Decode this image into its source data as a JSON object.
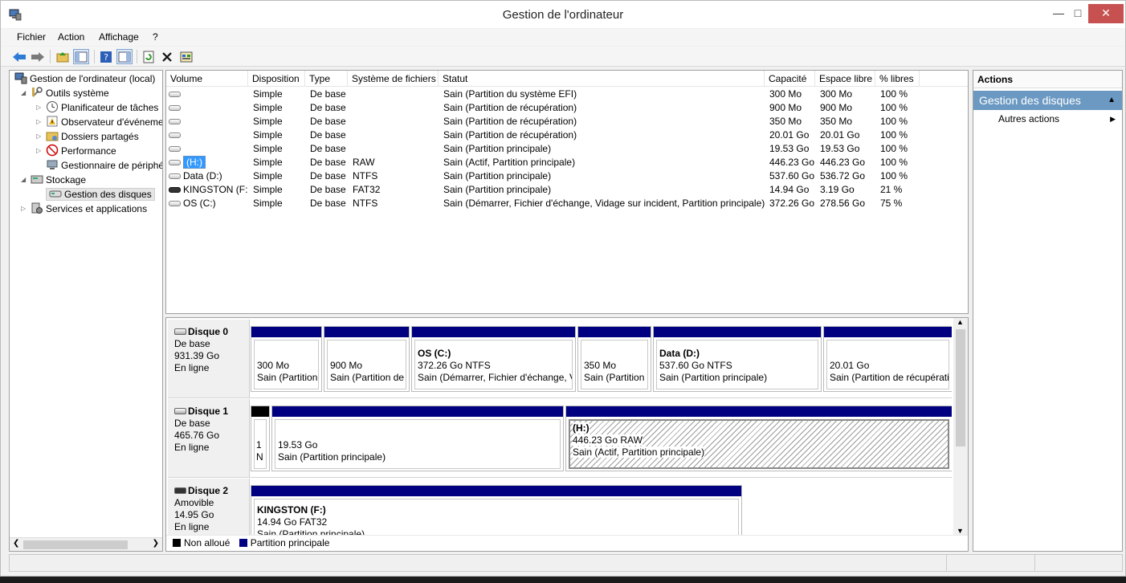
{
  "window": {
    "title": "Gestion de l'ordinateur"
  },
  "menu": [
    "Fichier",
    "Action",
    "Affichage",
    "?"
  ],
  "toolbar": {
    "icons": [
      "back-icon",
      "forward-icon",
      "up-icon",
      "show-tree-icon",
      "help-icon",
      "properties-icon",
      "refresh-icon",
      "delete-icon",
      "export-icon"
    ]
  },
  "tree": {
    "root": "Gestion de l'ordinateur (local)",
    "system_tools": "Outils système",
    "task_scheduler": "Planificateur de tâches",
    "event_viewer": "Observateur d'événeme",
    "shared_folders": "Dossiers partagés",
    "performance": "Performance",
    "device_manager": "Gestionnaire de périphé",
    "storage": "Stockage",
    "disk_management": "Gestion des disques",
    "services": "Services et applications"
  },
  "volumes": {
    "headers": [
      "Volume",
      "Disposition",
      "Type",
      "Système de fichiers",
      "Statut",
      "Capacité",
      "Espace libre",
      "% libres"
    ],
    "rows": [
      {
        "volume": "",
        "disposition": "Simple",
        "type": "De base",
        "fs": "",
        "status": "Sain (Partition du système EFI)",
        "capacity": "300 Mo",
        "free": "300 Mo",
        "pct": "100 %"
      },
      {
        "volume": "",
        "disposition": "Simple",
        "type": "De base",
        "fs": "",
        "status": "Sain (Partition de récupération)",
        "capacity": "900 Mo",
        "free": "900 Mo",
        "pct": "100 %"
      },
      {
        "volume": "",
        "disposition": "Simple",
        "type": "De base",
        "fs": "",
        "status": "Sain (Partition de récupération)",
        "capacity": "350 Mo",
        "free": "350 Mo",
        "pct": "100 %"
      },
      {
        "volume": "",
        "disposition": "Simple",
        "type": "De base",
        "fs": "",
        "status": "Sain (Partition de récupération)",
        "capacity": "20.01 Go",
        "free": "20.01 Go",
        "pct": "100 %"
      },
      {
        "volume": "",
        "disposition": "Simple",
        "type": "De base",
        "fs": "",
        "status": "Sain (Partition principale)",
        "capacity": "19.53 Go",
        "free": "19.53 Go",
        "pct": "100 %"
      },
      {
        "volume": "(H:)",
        "disposition": "Simple",
        "type": "De base",
        "fs": "RAW",
        "status": "Sain (Actif, Partition principale)",
        "capacity": "446.23 Go",
        "free": "446.23 Go",
        "pct": "100 %"
      },
      {
        "volume": "Data (D:)",
        "disposition": "Simple",
        "type": "De base",
        "fs": "NTFS",
        "status": "Sain (Partition principale)",
        "capacity": "537.60 Go",
        "free": "536.72 Go",
        "pct": "100 %"
      },
      {
        "volume": "KINGSTON (F:)",
        "disposition": "Simple",
        "type": "De base",
        "fs": "FAT32",
        "status": "Sain (Partition principale)",
        "capacity": "14.94 Go",
        "free": "3.19 Go",
        "pct": "21 %"
      },
      {
        "volume": "OS (C:)",
        "disposition": "Simple",
        "type": "De base",
        "fs": "NTFS",
        "status": "Sain (Démarrer, Fichier d'échange, Vidage sur incident, Partition principale)",
        "capacity": "372.26 Go",
        "free": "278.56 Go",
        "pct": "75 %"
      }
    ]
  },
  "disks": [
    {
      "name": "Disque 0",
      "kind": "De base",
      "size": "931.39 Go",
      "state": "En ligne",
      "partitions": [
        {
          "title": "",
          "size": "300 Mo",
          "status": "Sain (Partition"
        },
        {
          "title": "",
          "size": "900 Mo",
          "status": "Sain (Partition de"
        },
        {
          "title": "OS  (C:)",
          "size": "372.26 Go NTFS",
          "status": "Sain (Démarrer, Fichier d'échange, V"
        },
        {
          "title": "",
          "size": "350 Mo",
          "status": "Sain (Partition"
        },
        {
          "title": "Data  (D:)",
          "size": "537.60 Go NTFS",
          "status": "Sain (Partition principale)"
        },
        {
          "title": "",
          "size": "20.01 Go",
          "status": "Sain (Partition de récupérati"
        }
      ]
    },
    {
      "name": "Disque 1",
      "kind": "De base",
      "size": "465.76 Go",
      "state": "En ligne",
      "partitions": [
        {
          "title": "",
          "size": "1",
          "status": "N"
        },
        {
          "title": "",
          "size": "19.53 Go",
          "status": "Sain (Partition principale)"
        },
        {
          "title": "(H:)",
          "size": "446.23 Go RAW",
          "status": "Sain (Actif, Partition principale)"
        }
      ]
    },
    {
      "name": "Disque 2",
      "kind": "Amovible",
      "size": "14.95 Go",
      "state": "En ligne",
      "partitions": [
        {
          "title": "KINGSTON  (F:)",
          "size": "14.94 Go FAT32",
          "status": "Sain (Partition principale)"
        }
      ]
    }
  ],
  "legend": {
    "unallocated": "Non alloué",
    "primary": "Partition principale"
  },
  "colors": {
    "primary_partition": "#000080",
    "unallocated": "#000000",
    "actions_header": "#6b99c2"
  },
  "actions": {
    "header": "Actions",
    "group": "Gestion des disques",
    "more": "Autres actions"
  }
}
